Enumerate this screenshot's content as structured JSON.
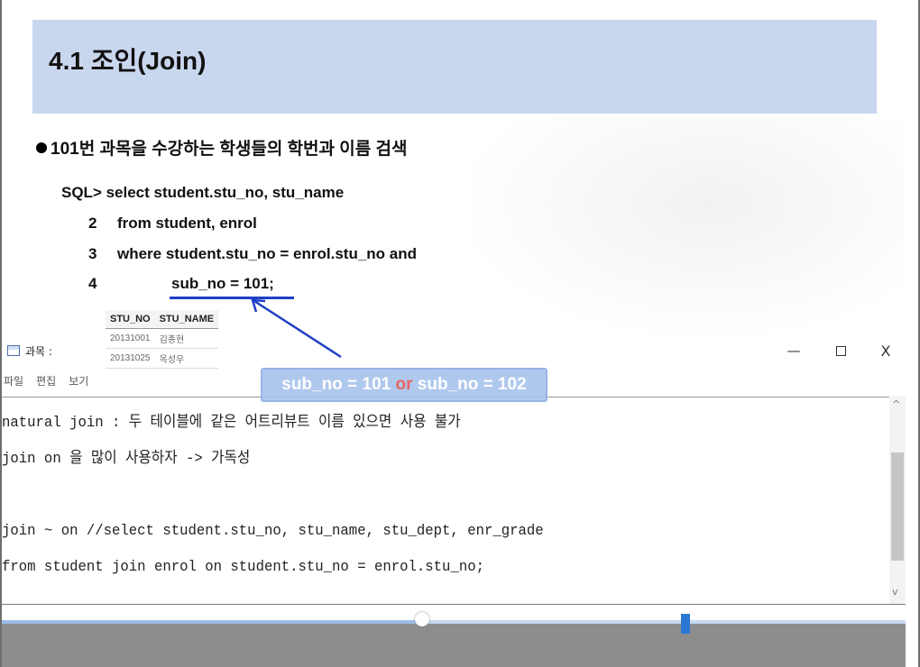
{
  "slide": {
    "title": "4.1 조인(Join)",
    "bullet": "101번 과목을 수강하는 학생들의 학번과 이름 검색",
    "sql": {
      "line1": "SQL> select student.stu_no, stu_name",
      "line2_num": "2",
      "line2": "from student, enrol",
      "line3_num": "3",
      "line3": "where student.stu_no = enrol.stu_no and",
      "line4_num": "4",
      "line4": "sub_no = 101;"
    },
    "result_table": {
      "headers": [
        "STU_NO",
        "STU_NAME"
      ],
      "rows": [
        [
          "20131001",
          "김종현"
        ],
        [
          "20131025",
          "옥성우"
        ]
      ]
    },
    "callout": {
      "left": "sub_no = 101 ",
      "or": "or",
      "right": " sub_no = 102"
    },
    "colors": {
      "title_bar": "#c9d7ee",
      "underline": "#1f3fc5",
      "callout_bg": "#a9c4ec",
      "or_text": "#e85a5a"
    }
  },
  "notepad": {
    "title": "과목 :",
    "window_buttons": {
      "minimize": "—",
      "close": "X"
    },
    "menu": [
      "파일",
      "편집",
      "보기"
    ],
    "lines": [
      "natural join : 두 테이블에 같은 어트리뷰트 이름 있으면 사용 불가",
      "join on 을 많이 사용하자 -> 가독성",
      "",
      "join ~ on //select student.stu_no, stu_name, stu_dept, enr_grade",
      "from student join enrol on student.stu_no = enrol.stu_no;"
    ],
    "scroll_up": "^",
    "scroll_down": "v"
  },
  "player": {
    "progress_fraction": 0.465,
    "icons": [
      "progress-knob-icon",
      "blue-marker-icon"
    ]
  }
}
